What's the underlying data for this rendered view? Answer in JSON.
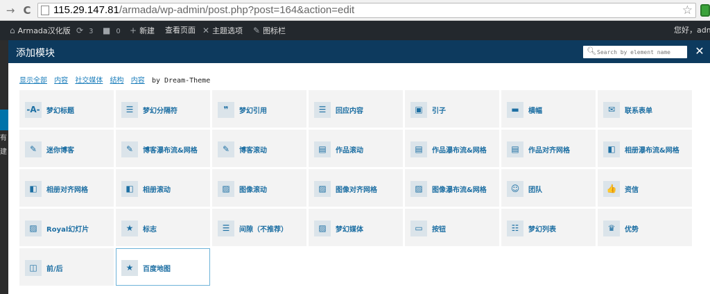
{
  "browser": {
    "back_icon": "→",
    "reload_icon": "C",
    "url_host": "115.29.147.81",
    "url_path": "/armada/wp-admin/post.php?post=164&action=edit",
    "star_icon": "☆"
  },
  "admin_bar": {
    "site_name": "Armada汉化版",
    "updates_count": "3",
    "comments_count": "0",
    "new_label": "新建",
    "view_page_label": "查看页面",
    "theme_options_label": "主题选项",
    "icon_bar_label": "图标栏",
    "greeting": "您好，admi"
  },
  "side_text": [
    "有",
    "建"
  ],
  "modal": {
    "title": "添加模块",
    "search_placeholder": "Search by element name",
    "close_label": "✕",
    "filters": [
      "显示全部",
      "内容",
      "社交媒体",
      "结构",
      "内容"
    ],
    "by_text": "by Dream-Theme",
    "tiles": [
      {
        "label": "梦幻标题",
        "icon": "-A-"
      },
      {
        "label": "梦幻分隔符",
        "icon": "☰"
      },
      {
        "label": "梦幻引用",
        "icon": "❞"
      },
      {
        "label": "回应内容",
        "icon": "☰"
      },
      {
        "label": "引子",
        "icon": "▣"
      },
      {
        "label": "横幅",
        "icon": "▬"
      },
      {
        "label": "联系表单",
        "icon": "✉"
      },
      {
        "label": "迷你博客",
        "icon": "✎"
      },
      {
        "label": "博客瀑布流&网格",
        "icon": "✎"
      },
      {
        "label": "博客滚动",
        "icon": "✎"
      },
      {
        "label": "作品滚动",
        "icon": "▤"
      },
      {
        "label": "作品瀑布流&网格",
        "icon": "▤"
      },
      {
        "label": "作品对齐网格",
        "icon": "▤"
      },
      {
        "label": "相册瀑布流&网格",
        "icon": "◧"
      },
      {
        "label": "相册对齐网格",
        "icon": "◧"
      },
      {
        "label": "相册滚动",
        "icon": "◧"
      },
      {
        "label": "图像滚动",
        "icon": "▨"
      },
      {
        "label": "图像对齐网格",
        "icon": "▨"
      },
      {
        "label": "图像瀑布流&网格",
        "icon": "▨"
      },
      {
        "label": "团队",
        "icon": "☺"
      },
      {
        "label": "资信",
        "icon": "👍"
      },
      {
        "label": "Royal幻灯片",
        "icon": "▨"
      },
      {
        "label": "标志",
        "icon": "★"
      },
      {
        "label": "间隙（不推荐）",
        "icon": "☰"
      },
      {
        "label": "梦幻媒体",
        "icon": "▨"
      },
      {
        "label": "按钮",
        "icon": "▭"
      },
      {
        "label": "梦幻列表",
        "icon": "☷"
      },
      {
        "label": "优势",
        "icon": "♛"
      },
      {
        "label": "前/后",
        "icon": "◫"
      },
      {
        "label": "百度地图",
        "icon": "★",
        "active": true
      }
    ]
  }
}
